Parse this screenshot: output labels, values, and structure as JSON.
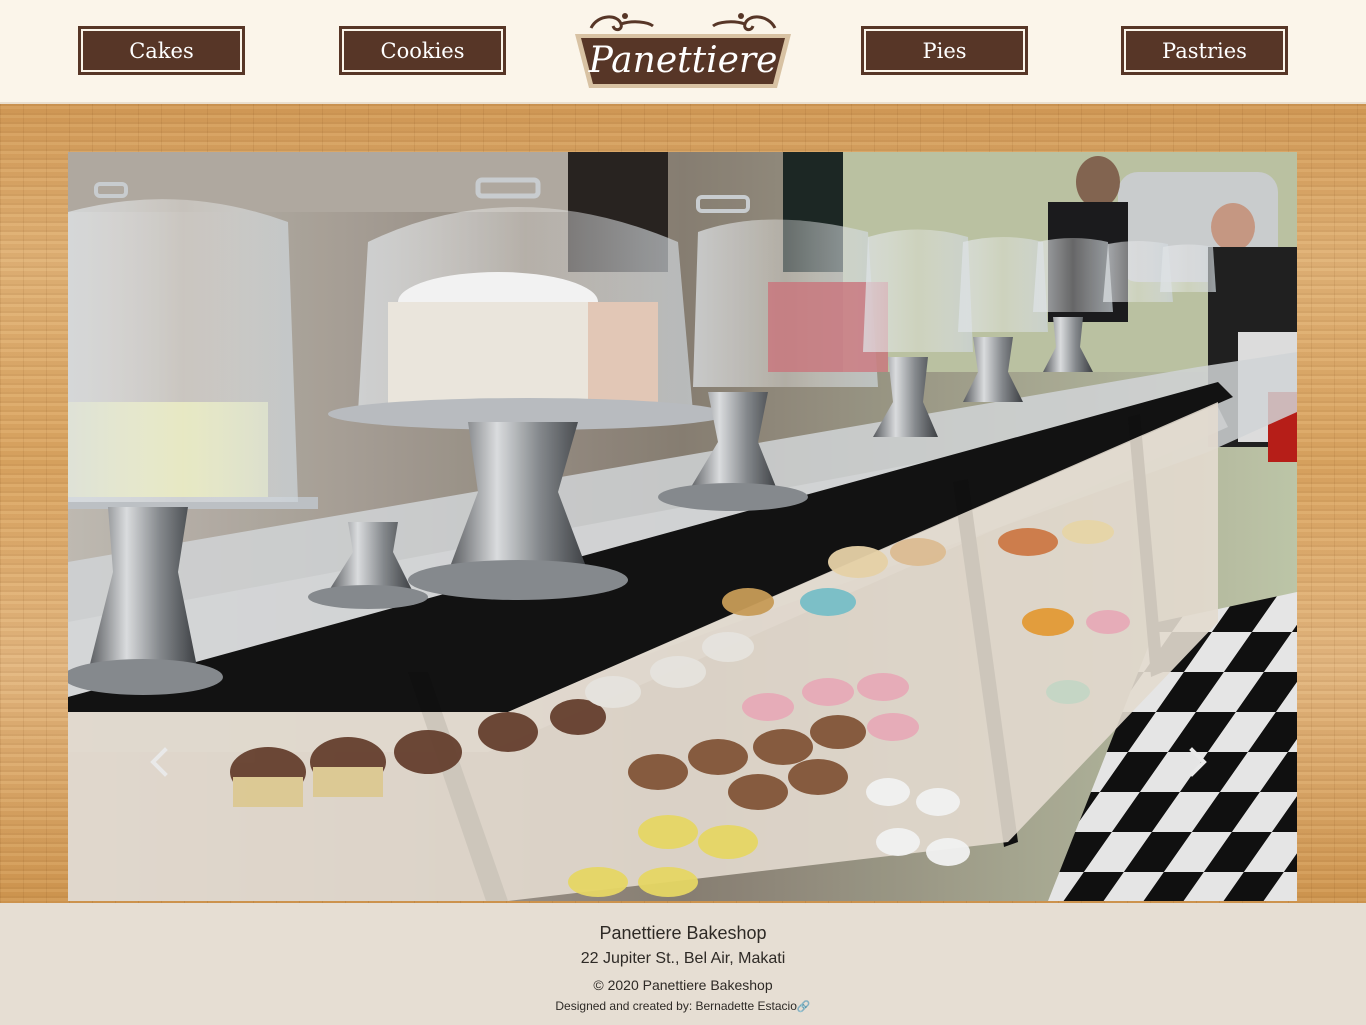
{
  "nav": {
    "cakes": "Cakes",
    "cookies": "Cookies",
    "pies": "Pies",
    "pastries": "Pastries"
  },
  "logo": {
    "text": "Panettiere"
  },
  "slideshow": {
    "prev_icon": "chevron-left-icon",
    "next_icon": "chevron-right-icon"
  },
  "footer": {
    "name": "Panettiere Bakeshop",
    "address": "22 Jupiter St., Bel Air, Makati",
    "copyright": "© 2020 Panettiere Bakeshop",
    "credits": "Designed and created by: Bernadette Estacio",
    "link_icon": "link-icon"
  },
  "colors": {
    "brand_brown": "#573627",
    "header_bg": "#fbf5ea",
    "footer_bg": "#e6ded3"
  }
}
